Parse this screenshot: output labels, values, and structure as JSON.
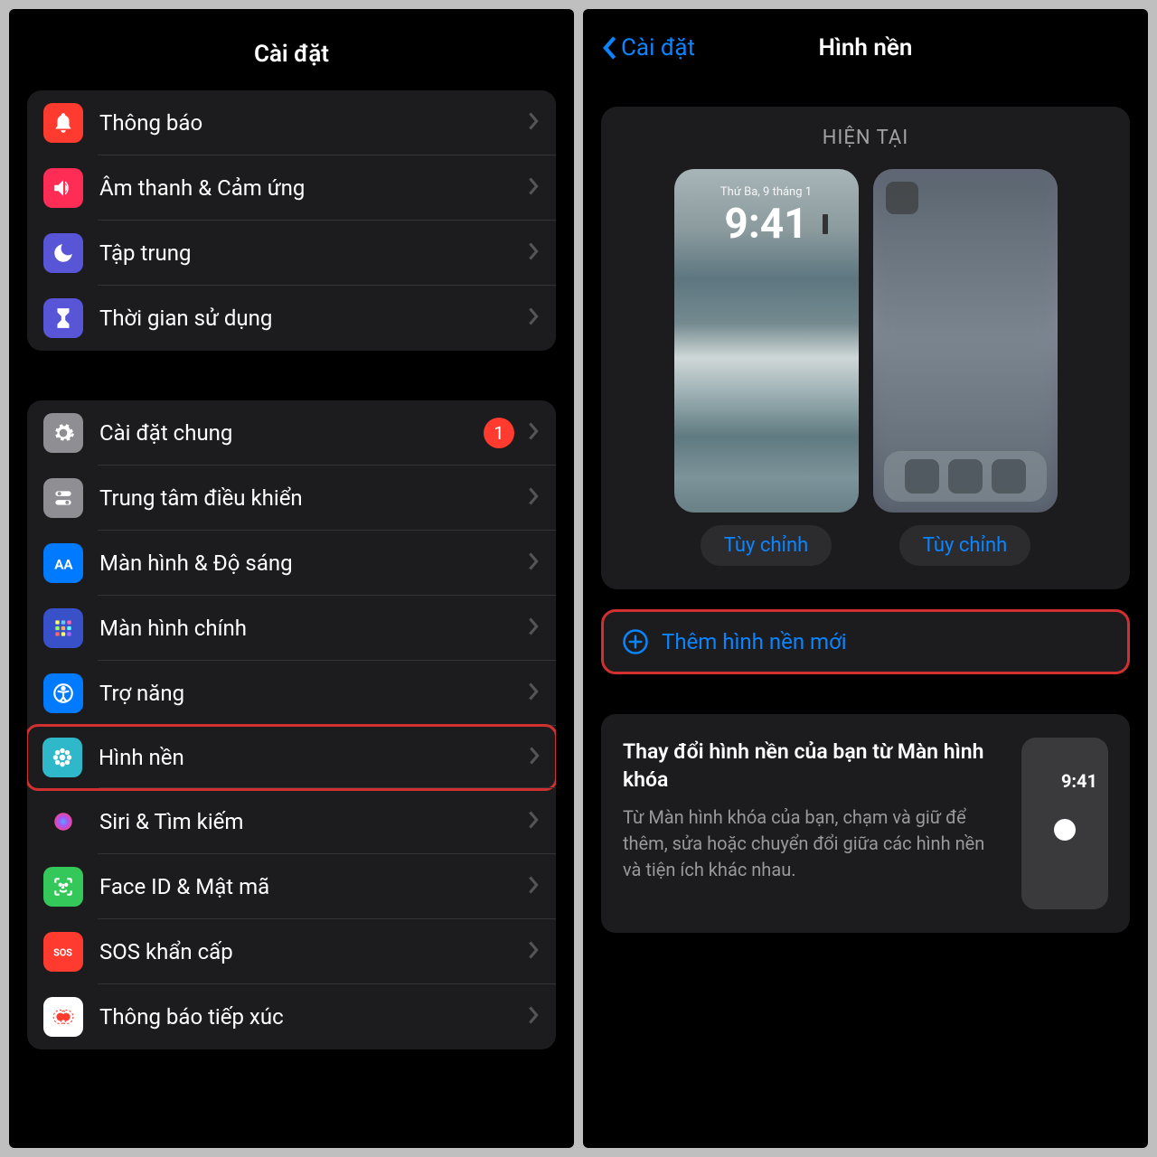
{
  "left": {
    "title": "Cài đặt",
    "group1": [
      {
        "label": "Thông báo",
        "icon": "bell"
      },
      {
        "label": "Âm thanh & Cảm ứng",
        "icon": "speaker"
      },
      {
        "label": "Tập trung",
        "icon": "moon"
      },
      {
        "label": "Thời gian sử dụng",
        "icon": "hourglass"
      }
    ],
    "group2": [
      {
        "label": "Cài đặt chung",
        "icon": "gear",
        "badge": "1"
      },
      {
        "label": "Trung tâm điều khiển",
        "icon": "toggles"
      },
      {
        "label": "Màn hình & Độ sáng",
        "icon": "aa"
      },
      {
        "label": "Màn hình chính",
        "icon": "grid"
      },
      {
        "label": "Trợ năng",
        "icon": "access"
      },
      {
        "label": "Hình nền",
        "icon": "flower",
        "highlight": true
      },
      {
        "label": "Siri & Tìm kiếm",
        "icon": "siri"
      },
      {
        "label": "Face ID & Mật mã",
        "icon": "faceid"
      },
      {
        "label": "SOS khẩn cấp",
        "icon": "sos"
      },
      {
        "label": "Thông báo tiếp xúc",
        "icon": "exposure"
      }
    ]
  },
  "right": {
    "back": "Cài đặt",
    "title": "Hình nền",
    "current_label": "HIỆN TẠI",
    "lock_date": "Thứ Ba, 9 tháng 1",
    "lock_time": "9:41",
    "customize": "Tùy chỉnh",
    "add_new": "Thêm hình nền mới",
    "info_title": "Thay đổi hình nền của bạn từ Màn hình khóa",
    "info_desc": "Từ Màn hình khóa của bạn, chạm và giữ để thêm, sửa hoặc chuyển đổi giữa các hình nền và tiện ích khác nhau.",
    "mini_time": "9:41"
  }
}
